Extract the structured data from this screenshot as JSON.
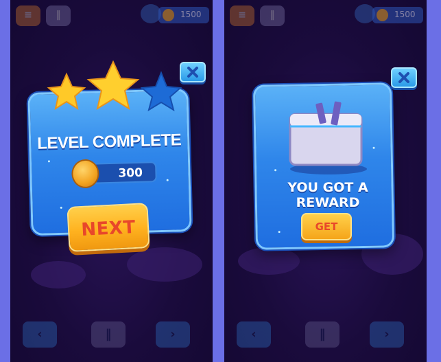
{
  "hud": {
    "menu_icon": "menu-icon",
    "pause_icon": "pause-icon",
    "mascot_icon": "bird-icon",
    "coins": "1500"
  },
  "level_complete": {
    "title": "LEVEL COMPLETE",
    "coins_earned": "300",
    "next_label": "NEXT",
    "stars_earned": 2,
    "stars_total": 3
  },
  "reward": {
    "title": "YOU GOT A REWARD",
    "get_label": "GET"
  },
  "footer": {
    "left_icon": "arrow-left-icon",
    "center_icon": "pause-icon",
    "right_icon": "arrow-right-icon"
  },
  "colors": {
    "outer_background": "#6b6fe6",
    "screen_background": "#1a0b3c",
    "panel_blue": "#2f86ea",
    "star_gold": "#ffc928",
    "star_empty": "#1d6bd6",
    "button_orange": "#ffb21f",
    "button_text_red": "#e8472a"
  }
}
